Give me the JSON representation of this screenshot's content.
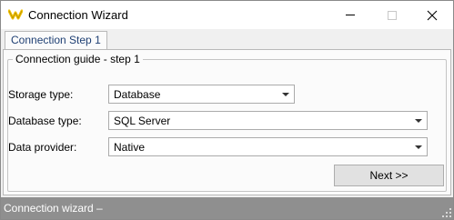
{
  "window": {
    "title": "Connection Wizard"
  },
  "tabs": [
    {
      "label": "Connection Step 1",
      "active": true
    }
  ],
  "group": {
    "title": "Connection guide - step 1"
  },
  "fields": {
    "storage_type": {
      "label": "Storage type:",
      "value": "Database"
    },
    "database_type": {
      "label": "Database type:",
      "value": "SQL Server"
    },
    "data_provider": {
      "label": "Data provider:",
      "value": "Native"
    }
  },
  "buttons": {
    "next": "Next >>"
  },
  "status": {
    "text": "Connection wizard –"
  },
  "icons": {
    "app": "wizard-app-icon",
    "minimize": "minimize-icon",
    "maximize": "maximize-icon",
    "close": "close-icon",
    "dropdown": "chevron-down-icon",
    "grip": "resize-grip-icon"
  },
  "colors": {
    "tab_text": "#1e3f73",
    "statusbar": "#8f8f8f",
    "app_icon": "#f2c200"
  }
}
